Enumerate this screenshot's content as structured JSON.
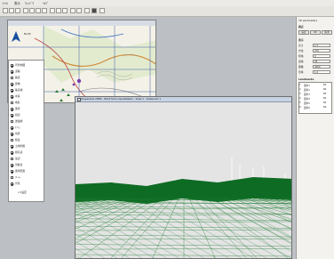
{
  "menu": [
    "ﾌｧｲﾙ",
    "表示",
    "ｳｨﾝﾄﾞｳ",
    "ﾍﾙﾌﾟ"
  ],
  "map_window": {
    "title": "",
    "compass_label": "North"
  },
  "layers": [
    {
      "label": "背景地図",
      "checked": true
    },
    {
      "label": "道路",
      "checked": true
    },
    {
      "label": "鉄道",
      "checked": false
    },
    {
      "label": "建物",
      "checked": true
    },
    {
      "label": "等高線",
      "checked": true
    },
    {
      "label": "水系",
      "checked": true
    },
    {
      "label": "地名",
      "checked": false
    },
    {
      "label": "風車",
      "checked": true
    },
    {
      "label": "視点",
      "checked": true
    },
    {
      "label": "送電線",
      "checked": false
    },
    {
      "label": "ﾒｯｼｭ",
      "checked": true
    },
    {
      "label": "境界",
      "checked": true
    },
    {
      "label": "植生",
      "checked": false
    },
    {
      "label": "土地利用",
      "checked": true
    },
    {
      "label": "標高点",
      "checked": true
    },
    {
      "label": "注記",
      "checked": false
    },
    {
      "label": "景観点",
      "checked": true
    },
    {
      "label": "風車配置",
      "checked": true
    },
    {
      "label": "ﾌﾚｰﾑ",
      "checked": false
    },
    {
      "label": "背景",
      "checked": true
    }
  ],
  "layer_footer": "ﾚｲﾔ設定",
  "view_window": {
    "title": "Perspective VIEW - Wind farm visualization  · View 1 · Viewpoint 1"
  },
  "right_panel": {
    "title": "3D parameters",
    "section1": "視点",
    "buttons": [
      "設定",
      "OK",
      "取消"
    ],
    "section2": "表示",
    "fields": [
      {
        "label": "高さ",
        "value": "1.5"
      },
      {
        "label": "方位",
        "value": "270"
      },
      {
        "label": "俯角",
        "value": "0"
      },
      {
        "label": "画角",
        "value": "45"
      },
      {
        "label": "距離",
        "value": "3000"
      },
      {
        "label": "倍率",
        "value": "1.0"
      }
    ],
    "table_header": "Landmarks",
    "table_rows": [
      [
        "1",
        "風車1",
        "60"
      ],
      [
        "2",
        "風車2",
        "60"
      ],
      [
        "3",
        "風車3",
        "60"
      ],
      [
        "4",
        "風車4",
        "60"
      ],
      [
        "5",
        "風車5",
        "60"
      ],
      [
        "6",
        "風車6",
        "60"
      ]
    ]
  },
  "colors": {
    "mesh": "#1a7a2e",
    "mesh_dense": "#0e6b24",
    "sky": "#e4e4e4"
  }
}
